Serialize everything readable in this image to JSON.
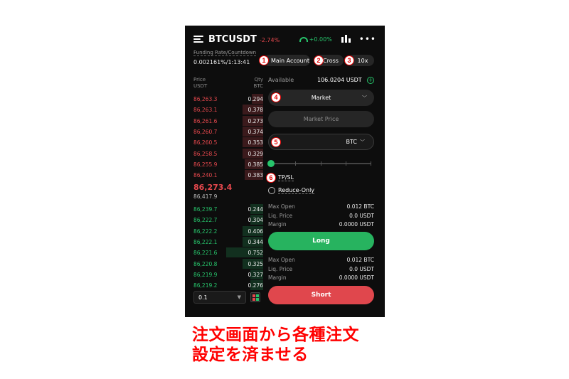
{
  "header": {
    "pair": "BTCUSDT",
    "change": "-2.74%",
    "sentiment": "+0.00%"
  },
  "funding": {
    "label": "Funding Rate/Countdown",
    "value": "0.002161%/1:13:41"
  },
  "account": {
    "mode": "Main Account",
    "margin": "Cross",
    "leverage": "10x"
  },
  "badges": [
    "1",
    "2",
    "3",
    "4",
    "5",
    "6"
  ],
  "orderbook": {
    "price_header": "Price",
    "price_unit": "USDT",
    "qty_header": "Qty",
    "qty_unit": "BTC",
    "asks": [
      {
        "price": "86,263.3",
        "qty": "0.294",
        "depth": 0.3
      },
      {
        "price": "86,263.1",
        "qty": "0.378",
        "depth": 0.56
      },
      {
        "price": "86,261.6",
        "qty": "0.273",
        "depth": 0.56
      },
      {
        "price": "86,260.7",
        "qty": "0.374",
        "depth": 0.56
      },
      {
        "price": "86,260.5",
        "qty": "0.353",
        "depth": 0.56
      },
      {
        "price": "86,258.5",
        "qty": "0.329",
        "depth": 0.56
      },
      {
        "price": "86,255.9",
        "qty": "0.385",
        "depth": 0.5
      },
      {
        "price": "86,240.1",
        "qty": "0.383",
        "depth": 0.5
      }
    ],
    "last_price": "86,273.4",
    "mark_price": "86,417.9",
    "bids": [
      {
        "price": "86,239.7",
        "qty": "0.244",
        "depth": 0.34
      },
      {
        "price": "86,222.7",
        "qty": "0.304",
        "depth": 0.34
      },
      {
        "price": "86,222.2",
        "qty": "0.406",
        "depth": 0.55
      },
      {
        "price": "86,222.1",
        "qty": "0.344",
        "depth": 0.55
      },
      {
        "price": "86,221.6",
        "qty": "0.752",
        "depth": 1.0
      },
      {
        "price": "86,220.8",
        "qty": "0.325",
        "depth": 0.55
      },
      {
        "price": "86,219.9",
        "qty": "0.327",
        "depth": 0.34
      },
      {
        "price": "86,219.2",
        "qty": "0.276",
        "depth": 0.34
      }
    ],
    "step": "0.1"
  },
  "form": {
    "available_label": "Available",
    "available_value": "106.0204 USDT",
    "order_type": "Market",
    "price_placeholder": "Market Price",
    "qty_unit": "BTC",
    "slider_level": 0,
    "tpsl_label": "TP/SL",
    "reduce_only_label": "Reduce-Only"
  },
  "long_info": [
    {
      "label": "Max Open",
      "value": "0.012 BTC"
    },
    {
      "label": "Liq. Price",
      "value": "0.0 USDT"
    },
    {
      "label": "Margin",
      "value": "0.0000 USDT"
    }
  ],
  "short_info": [
    {
      "label": "Max Open",
      "value": "0.012 BTC"
    },
    {
      "label": "Liq. Price",
      "value": "0.0 USDT"
    },
    {
      "label": "Margin",
      "value": "0.0000 USDT"
    }
  ],
  "buttons": {
    "long": "Long",
    "short": "Short"
  },
  "caption": {
    "line1": "注文画面から各種注文",
    "line2": "設定を済ませる"
  },
  "colors": {
    "red": "#e5484d",
    "green": "#27c46b",
    "badge": "#e60000"
  }
}
